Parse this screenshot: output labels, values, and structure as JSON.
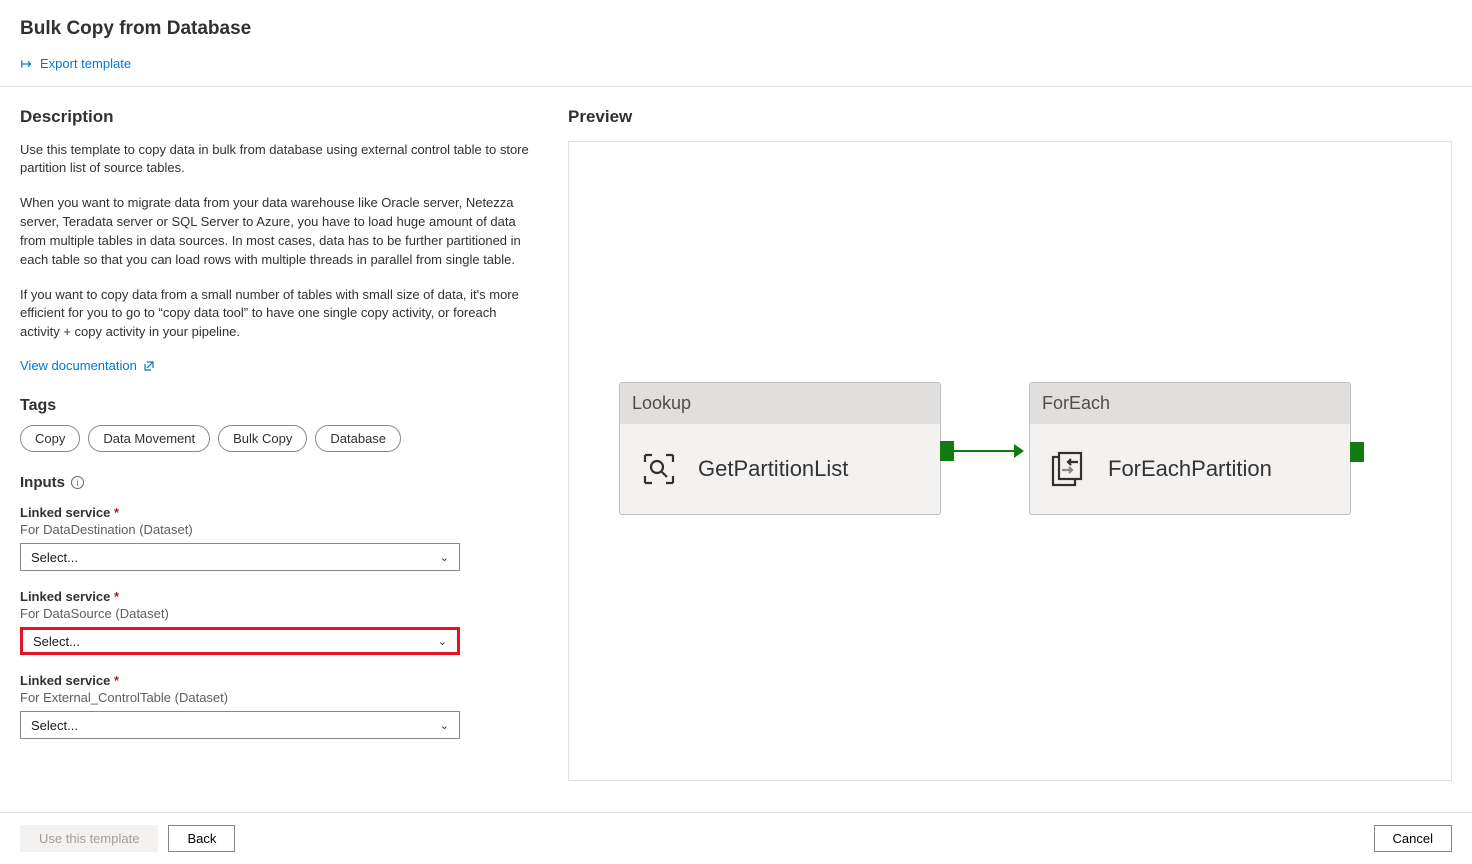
{
  "pageTitle": "Bulk Copy from Database",
  "toolbar": {
    "exportTemplate": "Export template"
  },
  "sections": {
    "description": "Description",
    "preview": "Preview",
    "tags": "Tags",
    "inputs": "Inputs"
  },
  "description": {
    "p1": "Use this template to copy data in bulk from database using external control table to store partition list of source tables.",
    "p2": "When you want to migrate data from your data warehouse like Oracle server, Netezza server, Teradata server or SQL Server to Azure, you have to load huge amount of data from multiple tables in data sources. In most cases, data has to be further partitioned in each table so that you can load rows with multiple threads in parallel from single table.",
    "p3": "If you want to copy data from a small number of tables with small size of data, it's more efficient for you to go to “copy data tool” to have one single copy activity, or foreach activity + copy activity in your pipeline.",
    "viewDoc": "View documentation"
  },
  "tags": [
    "Copy",
    "Data Movement",
    "Bulk Copy",
    "Database"
  ],
  "inputs": [
    {
      "label": "Linked service",
      "required": "*",
      "sublabel": "For DataDestination (Dataset)",
      "placeholder": "Select...",
      "highlighted": false
    },
    {
      "label": "Linked service",
      "required": "*",
      "sublabel": "For DataSource (Dataset)",
      "placeholder": "Select...",
      "highlighted": true
    },
    {
      "label": "Linked service",
      "required": "*",
      "sublabel": "For External_ControlTable (Dataset)",
      "placeholder": "Select...",
      "highlighted": false
    }
  ],
  "preview": {
    "activities": [
      {
        "type": "Lookup",
        "name": "GetPartitionList"
      },
      {
        "type": "ForEach",
        "name": "ForEachPartition"
      }
    ]
  },
  "footer": {
    "useThisTemplate": "Use this template",
    "back": "Back",
    "cancel": "Cancel"
  }
}
